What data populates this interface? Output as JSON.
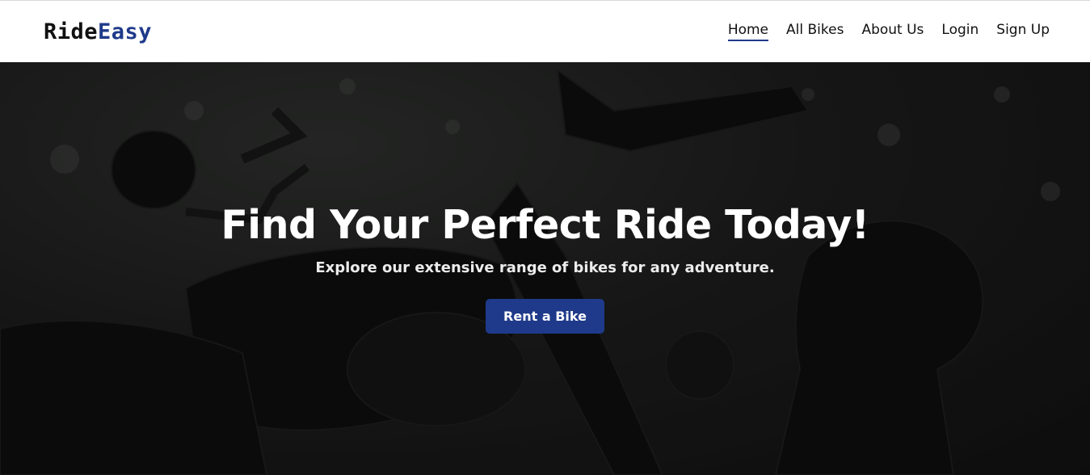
{
  "brand": {
    "part1": "Ride",
    "part2": "Easy"
  },
  "nav": {
    "items": [
      {
        "label": "Home",
        "active": true
      },
      {
        "label": "All Bikes"
      },
      {
        "label": "About Us"
      },
      {
        "label": "Login"
      },
      {
        "label": "Sign Up"
      }
    ]
  },
  "hero": {
    "title": "Find Your Perfect Ride Today!",
    "subtitle": "Explore our extensive range of bikes for any adventure.",
    "cta_label": "Rent a Bike"
  },
  "colors": {
    "accent": "#1f3a8a",
    "text": "#111111",
    "hero_overlay": "#0d0d0d"
  }
}
